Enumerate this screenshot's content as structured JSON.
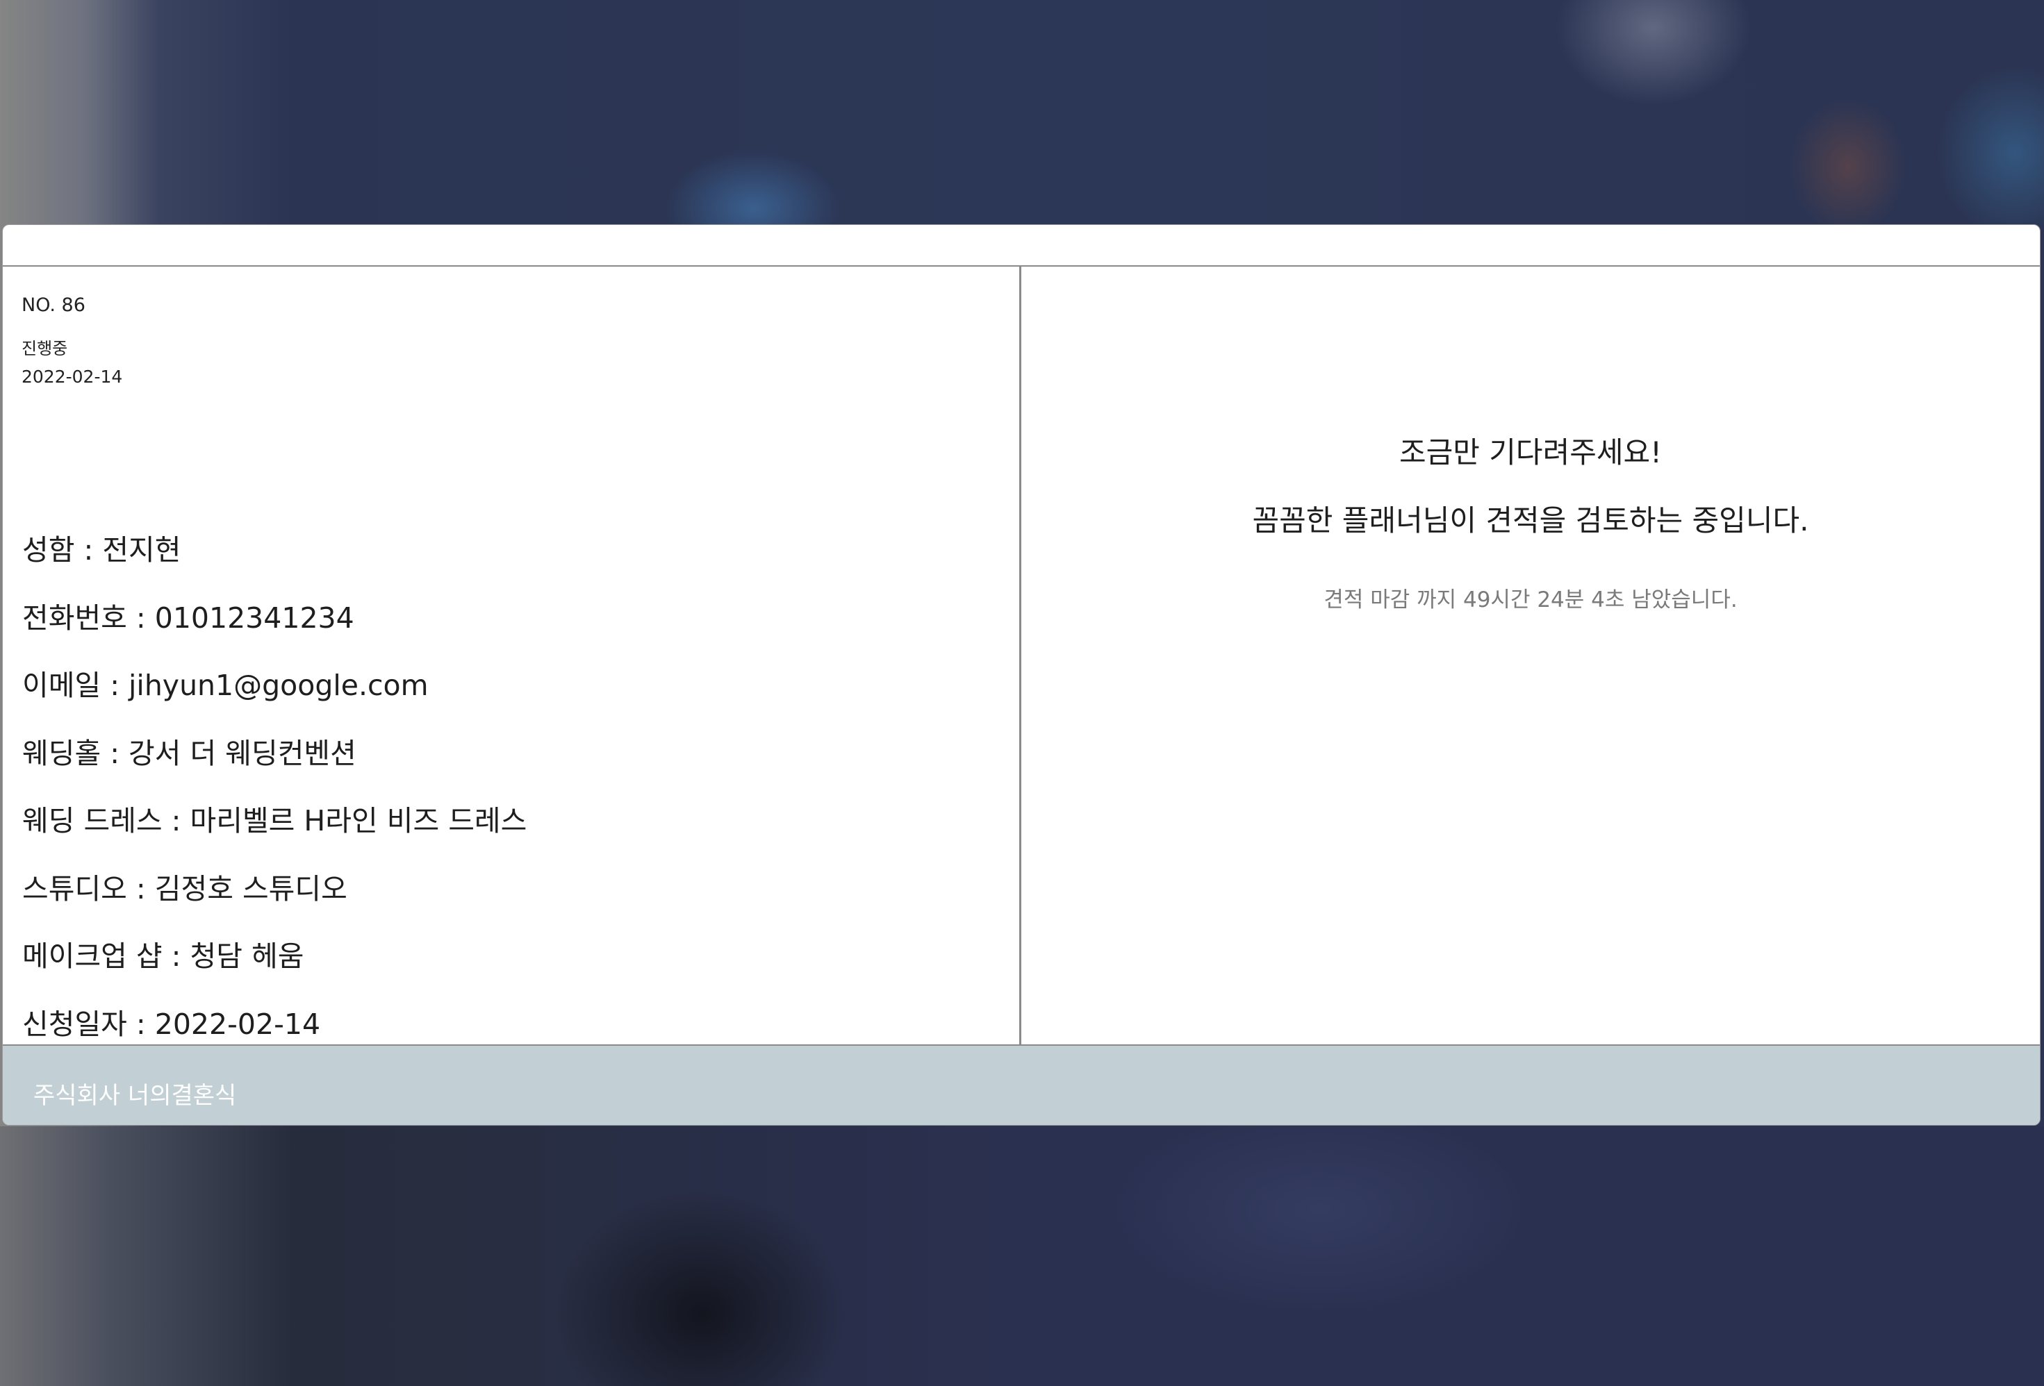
{
  "quote": {
    "number": "NO. 86",
    "status": "진행중",
    "date": "2022-02-14"
  },
  "customer": {
    "rows": [
      "성함 : 전지현",
      "전화번호 : 01012341234",
      "이메일 : jihyun1@google.com",
      "웨딩홀 : 강서 더 웨딩컨벤션",
      "웨딩 드레스 : 마리벨르 H라인 비즈 드레스",
      "스튜디오 : 김정호 스튜디오",
      "메이크업 샵 : 청담 헤움",
      "신청일자 : 2022-02-14"
    ]
  },
  "message": {
    "line1": "조금만 기다려주세요!",
    "line2": "꼼꼼한 플래너님이 견적을 검토하는 중입니다.",
    "deadline": "견적 마감 까지 49시간 24분 4초 남았습니다."
  },
  "footer": {
    "company": "주식회사 너의결혼식"
  }
}
